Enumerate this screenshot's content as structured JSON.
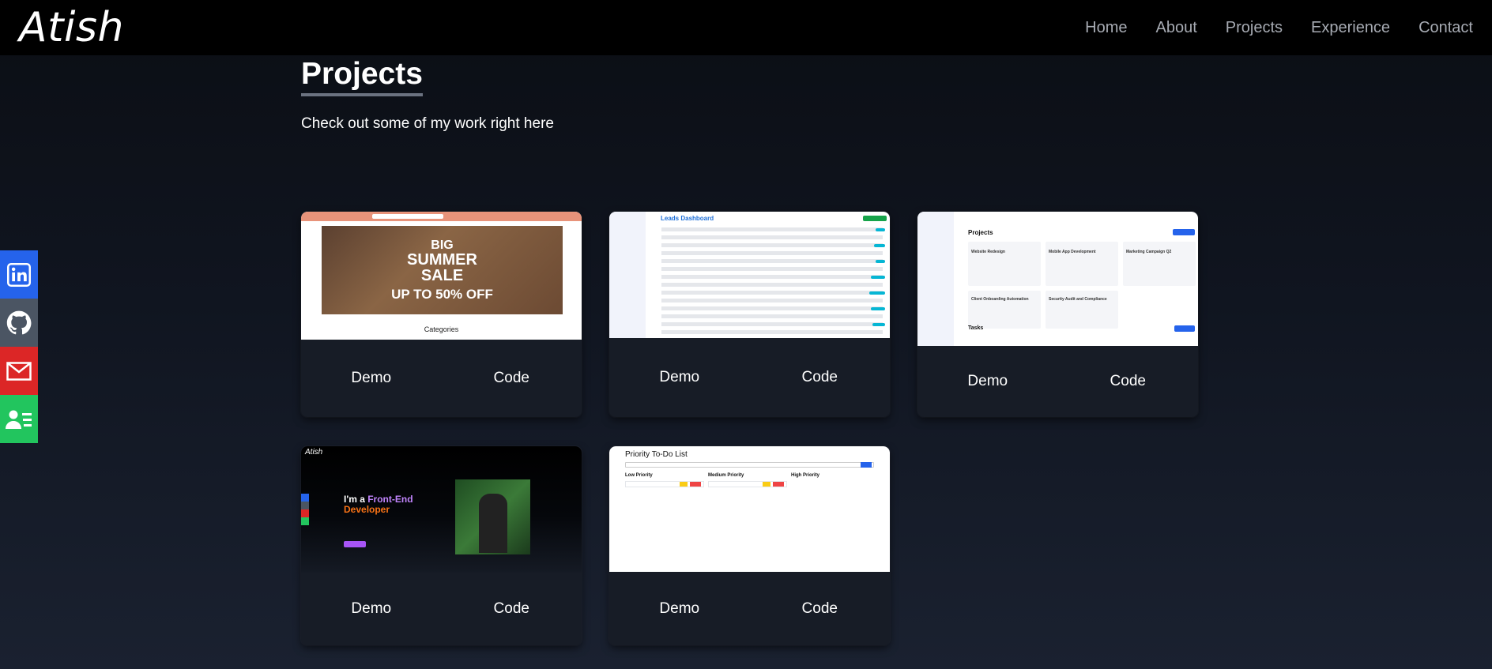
{
  "nav": {
    "brand": "Atish",
    "links": [
      "Home",
      "About",
      "Projects",
      "Experience",
      "Contact"
    ]
  },
  "section": {
    "title": "Projects",
    "subtitle": "Check out some of my work right here"
  },
  "social": {
    "items": [
      "linkedin-icon",
      "github-icon",
      "mail-icon",
      "contact-card-icon"
    ]
  },
  "colors": {
    "linkedin": "#2563eb",
    "github": "#4b5563",
    "mail": "#dc2626",
    "contact": "#22c55e"
  },
  "cards": [
    {
      "demo": "Demo",
      "code": "Code",
      "thumb": {
        "banner_big": "BIG",
        "banner_summer": "SUMMER",
        "banner_sale": "SALE",
        "banner_offer": "UP TO 50% OFF",
        "categories": "Categories"
      }
    },
    {
      "demo": "Demo",
      "code": "Code",
      "thumb": {
        "title": "Leads Dashboard"
      }
    },
    {
      "demo": "Demo",
      "code": "Code",
      "thumb": {
        "projects": "Projects",
        "tasks": "Tasks",
        "p1": "Website Redesign",
        "p2": "Mobile App Development",
        "p3": "Marketing Campaign Q2",
        "p4": "Client Onboarding Automation",
        "p5": "Security Audit and Compliance"
      }
    },
    {
      "demo": "Demo",
      "code": "Code",
      "thumb": {
        "brand": "Atish",
        "im": "I'm a",
        "role1": "Front-End",
        "role2": "Developer"
      }
    },
    {
      "demo": "Demo",
      "code": "Code",
      "thumb": {
        "title": "Priority To-Do List",
        "low": "Low Priority",
        "medium": "Medium Priority",
        "high": "High Priority"
      }
    }
  ]
}
